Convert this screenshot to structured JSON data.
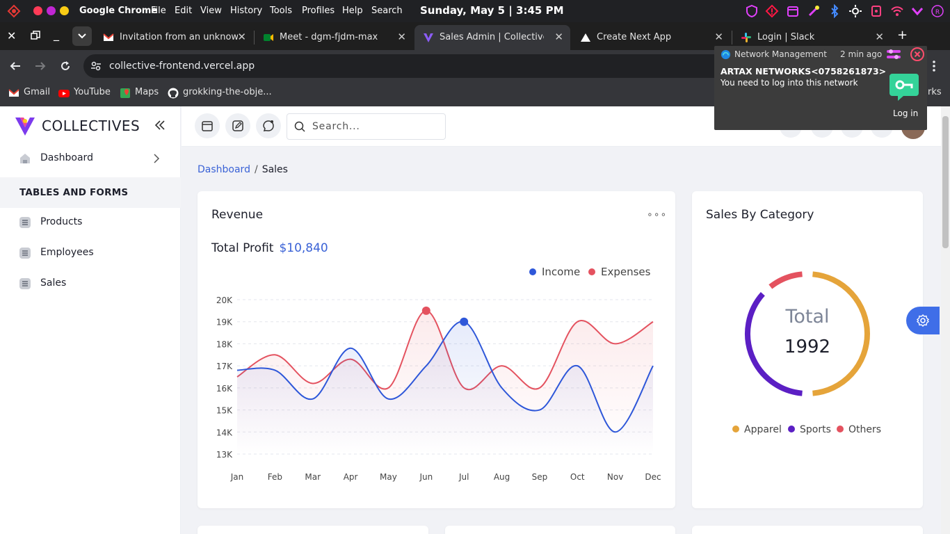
{
  "os": {
    "app_name": "Google Chrome",
    "menu": [
      "File",
      "Edit",
      "View",
      "History",
      "Tools",
      "Profiles",
      "Help",
      "Search"
    ],
    "clock": "Sunday, May 5 | 3:45 PM"
  },
  "tabs": [
    {
      "title": "Invitation from an unknown",
      "icon": "gmail-icon"
    },
    {
      "title": "Meet - dgm-fjdm-max",
      "icon": "meet-icon"
    },
    {
      "title": "Sales Admin | Collectives -",
      "icon": "collectives-icon",
      "active": true
    },
    {
      "title": "Create Next App",
      "icon": "nextjs-icon"
    },
    {
      "title": "Login | Slack",
      "icon": "slack-icon"
    }
  ],
  "address": {
    "url": "collective-frontend.vercel.app"
  },
  "bookmarks": [
    {
      "label": "Gmail"
    },
    {
      "label": "YouTube"
    },
    {
      "label": "Maps"
    },
    {
      "label": "grokking-the-obje..."
    }
  ],
  "bookmarks_right": "rks",
  "notification": {
    "app": "Network Management",
    "time": "2 min ago",
    "title": "ARTAX NETWORKS<0758261873>",
    "body": "You need to log into this network",
    "action": "Log in"
  },
  "sidebar": {
    "brand": "COLLECTIVES",
    "dashboard": "Dashboard",
    "section": "TABLES AND FORMS",
    "items": [
      "Products",
      "Employees",
      "Sales"
    ]
  },
  "header": {
    "search_placeholder": "Search..."
  },
  "breadcrumb": {
    "root": "Dashboard",
    "sep": "/",
    "current": "Sales"
  },
  "revenue": {
    "title": "Revenue",
    "more": "∘∘∘",
    "profit_label": "Total Profit",
    "profit_value": "$10,840"
  },
  "category": {
    "title": "Sales By Category",
    "total_label": "Total",
    "total_value": "1992",
    "legend": [
      "Apparel",
      "Sports",
      "Others"
    ]
  },
  "colors": {
    "income": "#2e57d9",
    "expenses": "#e4525f",
    "apparel": "#e5a43a",
    "sports": "#5b1fc4",
    "others": "#e4525f",
    "accent": "#3a62d6"
  },
  "chart_data": [
    {
      "type": "line",
      "x": [
        "Jan",
        "Feb",
        "Mar",
        "Apr",
        "May",
        "Jun",
        "Jul",
        "Aug",
        "Sep",
        "Oct",
        "Nov",
        "Dec"
      ],
      "yticks": [
        "13K",
        "14K",
        "15K",
        "16K",
        "17K",
        "18K",
        "19K",
        "20K"
      ],
      "ylim": [
        13000,
        20000
      ],
      "grid": true,
      "legend": "top-right",
      "series": [
        {
          "name": "Income",
          "values": [
            16800,
            16800,
            15500,
            17800,
            15500,
            17000,
            19000,
            16000,
            15000,
            17000,
            14000,
            17000
          ]
        },
        {
          "name": "Expenses",
          "values": [
            16500,
            17500,
            16200,
            17300,
            16000,
            19500,
            16000,
            17000,
            16000,
            19000,
            18000,
            19000
          ]
        }
      ]
    },
    {
      "type": "pie",
      "categories": [
        "Apparel",
        "Sports",
        "Others"
      ],
      "values": [
        50,
        38,
        12
      ]
    }
  ]
}
